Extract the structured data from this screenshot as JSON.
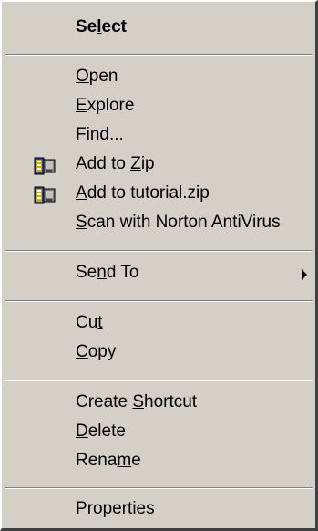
{
  "menu": {
    "items": [
      {
        "pre": "Se",
        "key": "l",
        "post": "ect"
      },
      {
        "pre": "",
        "key": "O",
        "post": "pen"
      },
      {
        "pre": "",
        "key": "E",
        "post": "xplore"
      },
      {
        "pre": "",
        "key": "F",
        "post": "ind..."
      },
      {
        "pre": "Add to ",
        "key": "Z",
        "post": "ip",
        "icon": "winzip-icon"
      },
      {
        "pre": "",
        "key": "A",
        "post": "dd to tutorial.zip",
        "icon": "winzip-icon"
      },
      {
        "pre": "",
        "key": "S",
        "post": "can with Norton AntiVirus"
      },
      {
        "pre": "Se",
        "key": "n",
        "post": "d To",
        "submenu": true
      },
      {
        "pre": "Cu",
        "key": "t",
        "post": ""
      },
      {
        "pre": "",
        "key": "C",
        "post": "opy"
      },
      {
        "pre": "Create ",
        "key": "S",
        "post": "hortcut"
      },
      {
        "pre": "",
        "key": "D",
        "post": "elete"
      },
      {
        "pre": "Rena",
        "key": "m",
        "post": "e"
      },
      {
        "pre": "P",
        "key": "r",
        "post": "operties"
      }
    ]
  },
  "icons": {
    "zip": "winzip-icon",
    "submenu": "submenu-arrow-icon"
  },
  "colors": {
    "menu_face": "#d4d0c8",
    "shadow": "#808080",
    "highlight": "#ffffff",
    "text": "#000000"
  }
}
